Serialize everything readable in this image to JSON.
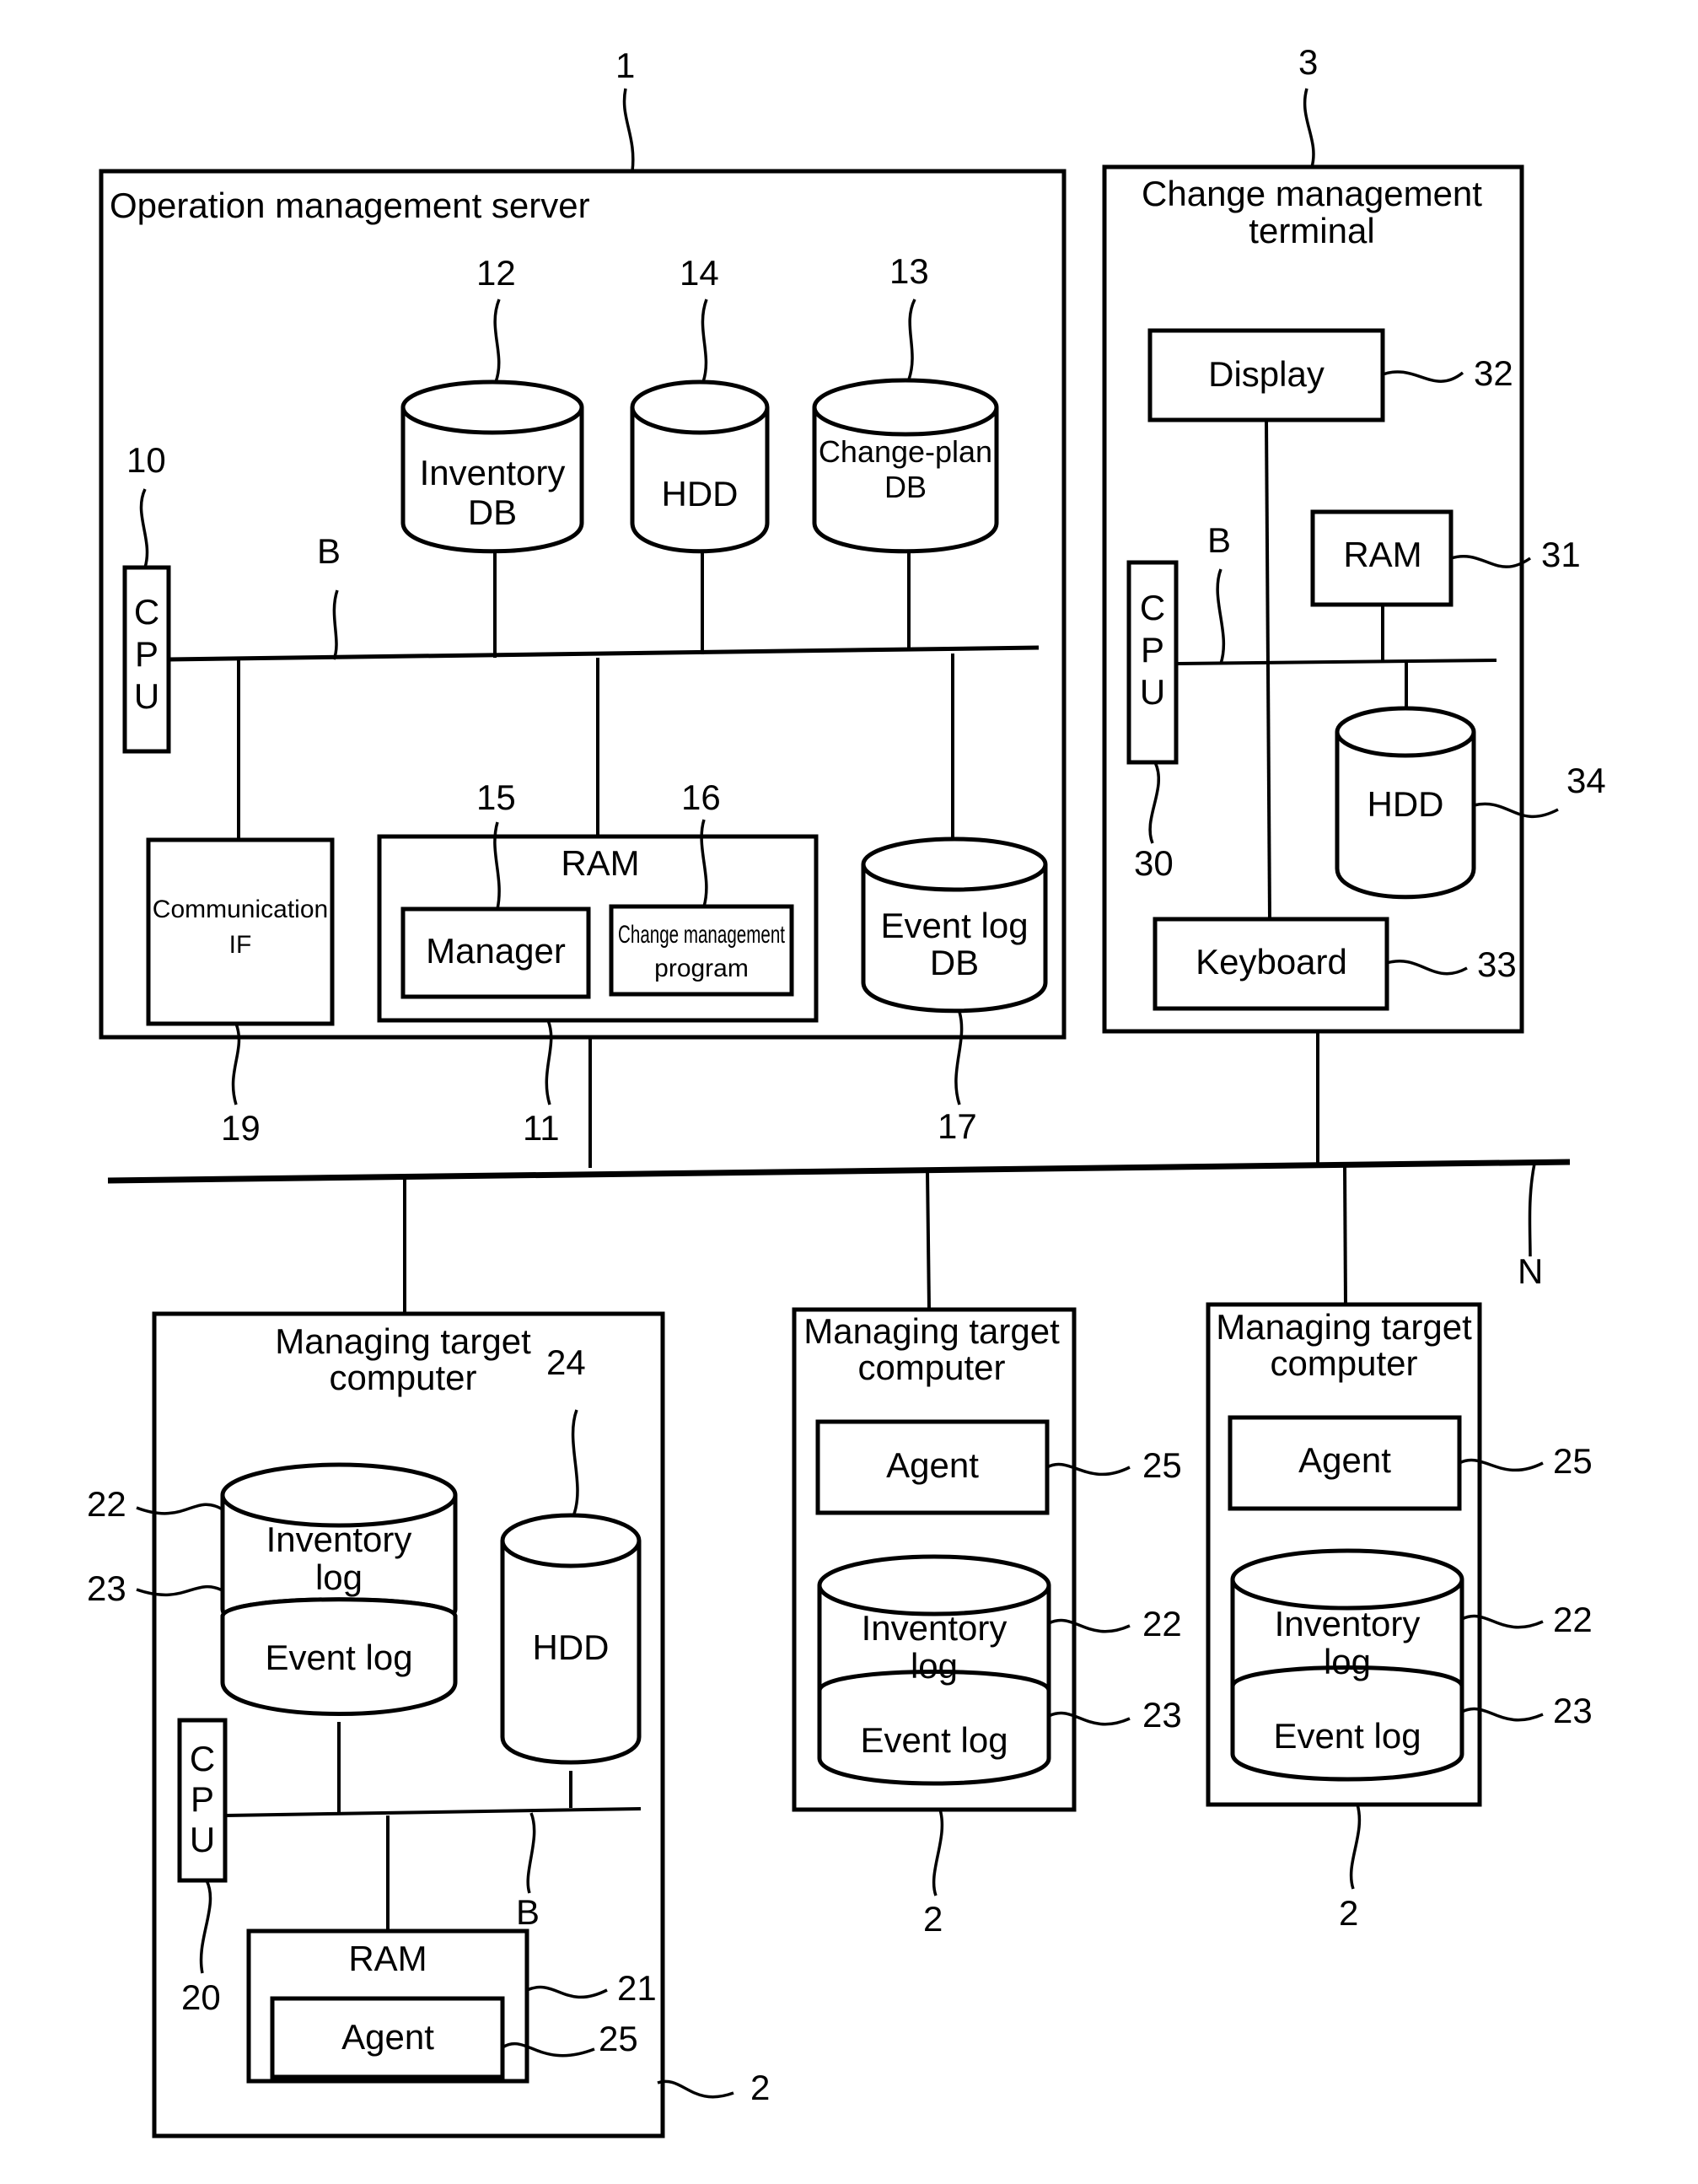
{
  "figure": {
    "operation_server": {
      "ref": "1",
      "title": "Operation management server",
      "cpu": {
        "ref": "10",
        "label": "CPU"
      },
      "bus": {
        "ref": "B"
      },
      "inventory_db": {
        "ref": "12",
        "line1": "Inventory",
        "line2": "DB"
      },
      "hdd": {
        "ref": "14",
        "label": "HDD"
      },
      "change_plan_db": {
        "ref": "13",
        "line1": "Change-plan",
        "line2": "DB"
      },
      "communication_if": {
        "ref": "19",
        "line1": "Communication",
        "line2": "IF"
      },
      "ram": {
        "ref": "11",
        "label": "RAM"
      },
      "manager": {
        "ref": "15",
        "label": "Manager"
      },
      "change_program": {
        "ref": "16",
        "line1": "Change management",
        "line2": "program"
      },
      "event_log_db": {
        "ref": "17",
        "line1": "Event log",
        "line2": "DB"
      }
    },
    "change_terminal": {
      "ref": "3",
      "title_line1": "Change management",
      "title_line2": "terminal",
      "display": {
        "ref": "32",
        "label": "Display"
      },
      "ram": {
        "ref": "31",
        "label": "RAM"
      },
      "cpu": {
        "ref": "30",
        "label": "CPU"
      },
      "bus": {
        "ref": "B"
      },
      "hdd": {
        "ref": "34",
        "label": "HDD"
      },
      "keyboard": {
        "ref": "33",
        "label": "Keyboard"
      }
    },
    "network": {
      "ref": "N"
    },
    "target_detailed": {
      "ref": "2",
      "title_line1": "Managing target",
      "title_line2": "computer",
      "log_db": {
        "inventory_ref": "22",
        "inventory_line1": "Inventory",
        "inventory_line2": "log",
        "event_ref": "23",
        "event_label": "Event log"
      },
      "hdd": {
        "ref": "24",
        "label": "HDD"
      },
      "cpu": {
        "ref": "20",
        "label": "CPU"
      },
      "bus": {
        "ref": "B"
      },
      "ram": {
        "ref": "21",
        "label": "RAM"
      },
      "agent": {
        "ref": "25",
        "label": "Agent"
      }
    },
    "target_simple": [
      {
        "ref": "2",
        "title_line1": "Managing target",
        "title_line2": "computer",
        "agent": {
          "ref": "25",
          "label": "Agent"
        },
        "inventory_ref": "22",
        "inventory_line1": "Inventory",
        "inventory_line2": "log",
        "event_ref": "23",
        "event_label": "Event log"
      },
      {
        "ref": "2",
        "title_line1": "Managing target",
        "title_line2": "computer",
        "agent": {
          "ref": "25",
          "label": "Agent"
        },
        "inventory_ref": "22",
        "inventory_line1": "Inventory",
        "inventory_line2": "log",
        "event_ref": "23",
        "event_label": "Event log"
      }
    ]
  }
}
